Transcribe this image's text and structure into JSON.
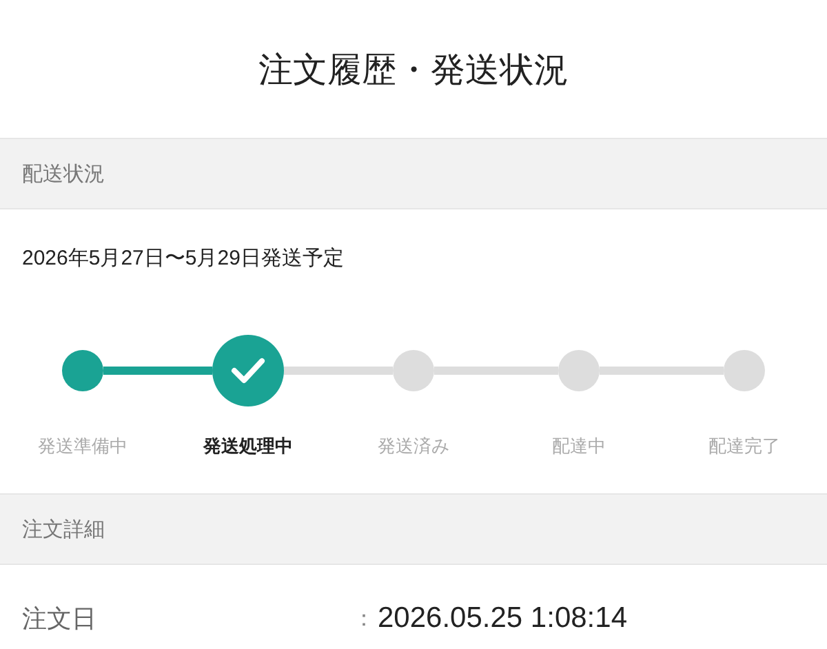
{
  "title": "注文履歴・発送状況",
  "shipping": {
    "heading": "配送状況",
    "estimate": "2026年5月27日〜5月29日発送予定",
    "steps": [
      {
        "label": "発送準備中",
        "completed": true,
        "selected": false
      },
      {
        "label": "発送処理中",
        "completed": true,
        "selected": true
      },
      {
        "label": "発送済み",
        "completed": false,
        "selected": false
      },
      {
        "label": "配達中",
        "completed": false,
        "selected": false
      },
      {
        "label": "配達完了",
        "completed": false,
        "selected": false
      }
    ]
  },
  "details": {
    "heading": "注文詳細",
    "rows": [
      {
        "label": "注文日",
        "separator": "：",
        "value": "2026.05.25 1:08:14"
      }
    ]
  }
}
